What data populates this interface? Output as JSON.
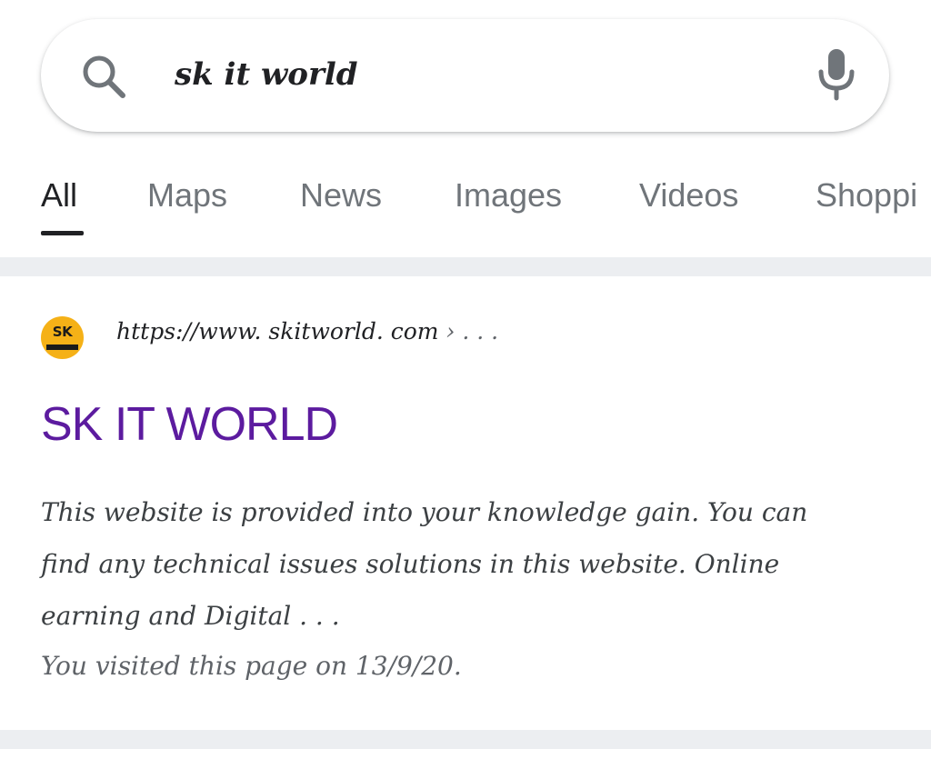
{
  "search": {
    "query": "sk it world",
    "icon": "search-icon",
    "mic_icon": "mic-icon"
  },
  "tabs": [
    {
      "label": "All",
      "active": true
    },
    {
      "label": "Maps",
      "active": false
    },
    {
      "label": "News",
      "active": false
    },
    {
      "label": "Images",
      "active": false
    },
    {
      "label": "Videos",
      "active": false
    },
    {
      "label": "Shoppi",
      "active": false
    }
  ],
  "result": {
    "favicon_text": "SK",
    "url": "https://www. skitworld. com",
    "url_suffix": " › . . .",
    "title": "SK IT WORLD",
    "snippet": "This website is provided into your knowledge gain.  You can find any technical issues solutions in this website.  Online earning and Digital . . .",
    "visited": "You visited this page on 13/9/20."
  },
  "colors": {
    "title_visited": "#5c1b9f",
    "favicon_bg": "#f5b117",
    "separator": "#eceef1"
  }
}
